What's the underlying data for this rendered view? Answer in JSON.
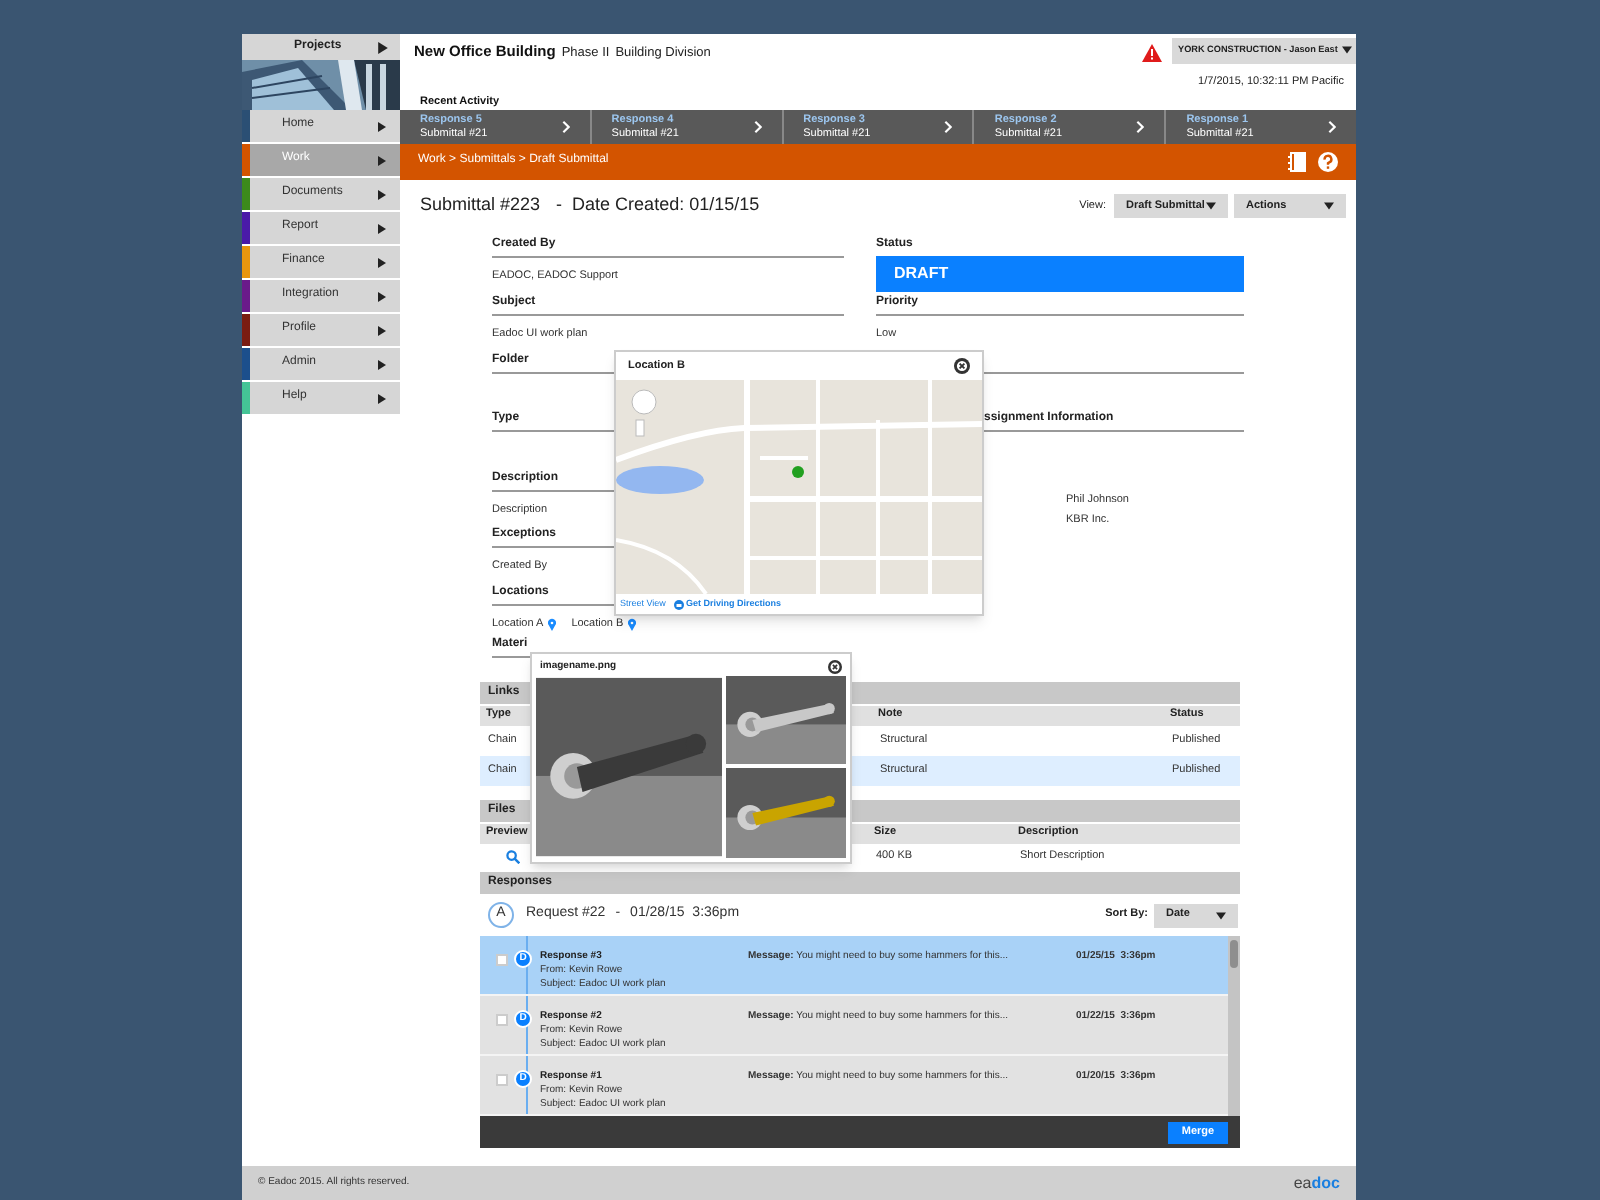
{
  "sidebar": {
    "projects_label": "Projects",
    "items": [
      {
        "label": "Home",
        "selected": false,
        "color": "#2b4f74"
      },
      {
        "label": "Work",
        "selected": true,
        "color": "#d35400"
      },
      {
        "label": "Documents",
        "selected": false,
        "color": "#3c8a1c"
      },
      {
        "label": "Report",
        "selected": false,
        "color": "#4a1aa8"
      },
      {
        "label": "Finance",
        "selected": false,
        "color": "#e8960e"
      },
      {
        "label": "Integration",
        "selected": false,
        "color": "#6a1a8a"
      },
      {
        "label": "Profile",
        "selected": false,
        "color": "#7a1c12"
      },
      {
        "label": "Admin",
        "selected": false,
        "color": "#1c4f8c"
      },
      {
        "label": "Help",
        "selected": false,
        "color": "#44c496"
      }
    ]
  },
  "header": {
    "project": "New Office Building",
    "phase": "Phase II",
    "division": "Building Division",
    "alert": true,
    "company_menu": "YORK CONSTRUCTION - Jason East",
    "timestamp": "1/7/2015, 10:32:11 PM Pacific"
  },
  "recent_activity": {
    "title": "Recent Activity",
    "items": [
      {
        "title": "Response 5",
        "subtitle": "Submittal #21"
      },
      {
        "title": "Response 4",
        "subtitle": "Submittal #21"
      },
      {
        "title": "Response 3",
        "subtitle": "Submittal #21"
      },
      {
        "title": "Response 2",
        "subtitle": "Submittal #21"
      },
      {
        "title": "Response 1",
        "subtitle": "Submittal #21"
      }
    ]
  },
  "breadcrumb": "Work > Submittals > Draft Submittal",
  "submittal": {
    "title": "Submittal #223",
    "separator": "-",
    "date": "Date Created: 01/15/15",
    "view_label": "View:",
    "view_value": "Draft Submittal",
    "actions": "Actions"
  },
  "fields_left": [
    {
      "label": "Created By",
      "value": "EADOC, EADOC Support"
    },
    {
      "label": "Subject",
      "value": "Eadoc UI work plan"
    },
    {
      "label": "Folder"
    },
    {
      "label": "Type"
    },
    {
      "label": "Description",
      "value": "Description"
    },
    {
      "label": "Exceptions",
      "value": "Created By"
    },
    {
      "label": "Locations",
      "locations": [
        "Location A",
        "Location B"
      ]
    },
    {
      "label": "Materi"
    }
  ],
  "status": {
    "label": "Status",
    "value": "DRAFT"
  },
  "priority": {
    "label": "Priority",
    "value": "Low"
  },
  "assignment": {
    "label": "ssignment Information",
    "values": [
      "Phil Johnson",
      "KBR Inc."
    ]
  },
  "links": {
    "title": "Links",
    "columns": [
      "Type",
      "Note",
      "Status"
    ],
    "rows": [
      {
        "type": "Chain",
        "note": "Structural",
        "status": "Published",
        "selected": false
      },
      {
        "type": "Chain",
        "note": "Structural",
        "status": "Published",
        "selected": true
      }
    ]
  },
  "files": {
    "title": "Files",
    "columns": [
      "Preview",
      "Size",
      "Description"
    ],
    "rows": [
      {
        "size": "400 KB",
        "description": "Short Description"
      }
    ]
  },
  "responses": {
    "title": "Responses",
    "request": {
      "badge": "A",
      "title": "Request #22",
      "separator": "-",
      "date": "01/28/15  3:36pm"
    },
    "sort_label": "Sort By:",
    "sort_value": "Date",
    "merge": "Merge",
    "items": [
      {
        "badge": "D",
        "title": "Response #3",
        "from": "From: Kevin Rowe",
        "subject": "Subject: Eadoc UI work plan",
        "message": "**Message:** You might need to buy some hammers for this...",
        "date": "01/25/15  3:36pm",
        "selected": true,
        "checked": false
      },
      {
        "badge": "D",
        "title": "Response #2",
        "from": "From: Kevin Rowe",
        "subject": "Subject: Eadoc UI work plan",
        "message": "**Message:** You might need to buy some hammers for this...",
        "date": "01/22/15  3:36pm",
        "selected": false,
        "checked": false
      },
      {
        "badge": "D",
        "title": "Response #1",
        "from": "From: Kevin Rowe",
        "subject": "Subject: Eadoc UI work plan",
        "message": "**Message:** You might need to buy some hammers for this...",
        "date": "01/20/15  3:36pm",
        "selected": false,
        "checked": false
      }
    ]
  },
  "map_popup": {
    "title": "Location B",
    "street_view": "Street View",
    "directions": "Get Driving Directions"
  },
  "image_popup": {
    "title": "imagename.png"
  },
  "footer": {
    "copyright": "© Eadoc 2015. All rights reserved.",
    "logo_left": "ea",
    "logo_right": "doc"
  }
}
